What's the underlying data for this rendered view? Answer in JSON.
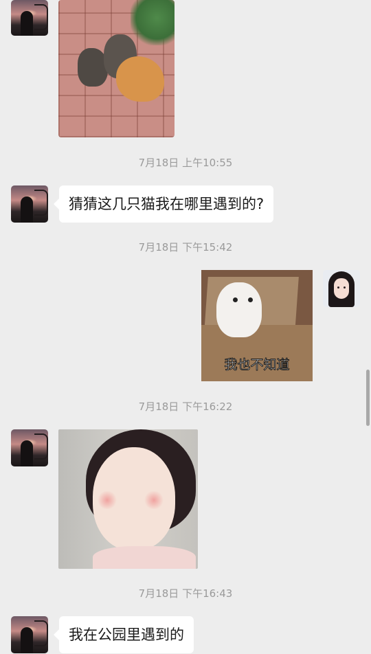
{
  "messages": {
    "m1": {
      "type": "image",
      "side": "left",
      "image_desc": "cats-on-brick-photo"
    },
    "t1": "7月18日 上午10:55",
    "m2": {
      "type": "text",
      "side": "left",
      "text": "猜猜这几只猫我在哪里遇到的?"
    },
    "t2": "7月18日 下午15:42",
    "m3": {
      "type": "sticker",
      "side": "right",
      "caption": "我也不知道"
    },
    "t3": "7月18日 下午16:22",
    "m4": {
      "type": "sticker",
      "side": "left",
      "image_desc": "baby-puffed-cheeks-sticker"
    },
    "t4": "7月18日 下午16:43",
    "m5": {
      "type": "text",
      "side": "left",
      "text": "我在公园里遇到的"
    }
  },
  "colors": {
    "background": "#ededed",
    "bubble_left": "#ffffff",
    "timestamp": "#9a9a9a"
  }
}
